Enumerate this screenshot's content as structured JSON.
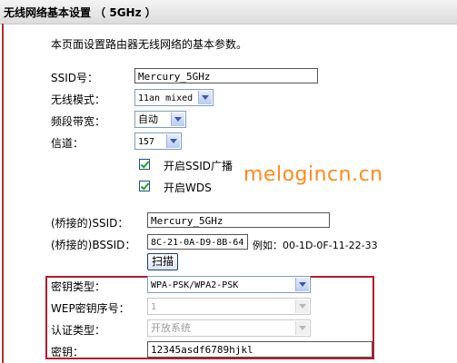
{
  "window": {
    "title": "无线网络基本设置 （ 5GHz ）"
  },
  "intro": "本页面设置路由器无线网络的基本参数。",
  "basic": {
    "ssid_label": "SSID号：",
    "ssid_value": "Mercury_5GHz",
    "mode_label": "无线模式：",
    "mode_value": "11an mixed",
    "bandwidth_label": "频段带宽：",
    "bandwidth_value": "自动",
    "channel_label": "信道：",
    "channel_value": "157",
    "broadcast_label": "开启SSID广播",
    "wds_label": "开启WDS"
  },
  "bridge": {
    "ssid_label": "(桥接的)SSID：",
    "ssid_value": "Mercury_5GHz",
    "bssid_label": "(桥接的)BSSID：",
    "bssid_value": "8C-21-0A-D9-8B-64",
    "bssid_example": "例如：00-1D-0F-11-22-33",
    "scan_label": "扫描"
  },
  "security": {
    "key_type_label": "密钥类型：",
    "key_type_value": "WPA-PSK/WPA2-PSK",
    "wep_index_label": "WEP密钥序号：",
    "wep_index_value": "1",
    "auth_type_label": "认证类型：",
    "auth_type_value": "开放系统",
    "key_label": "密钥：",
    "key_value": "12345asdf6789hjkl"
  },
  "watermark": "melogincn.cn",
  "colors": {
    "highlight_box": "#b8182c",
    "watermark": "#ff8a1c",
    "checkmark": "#21a121"
  }
}
